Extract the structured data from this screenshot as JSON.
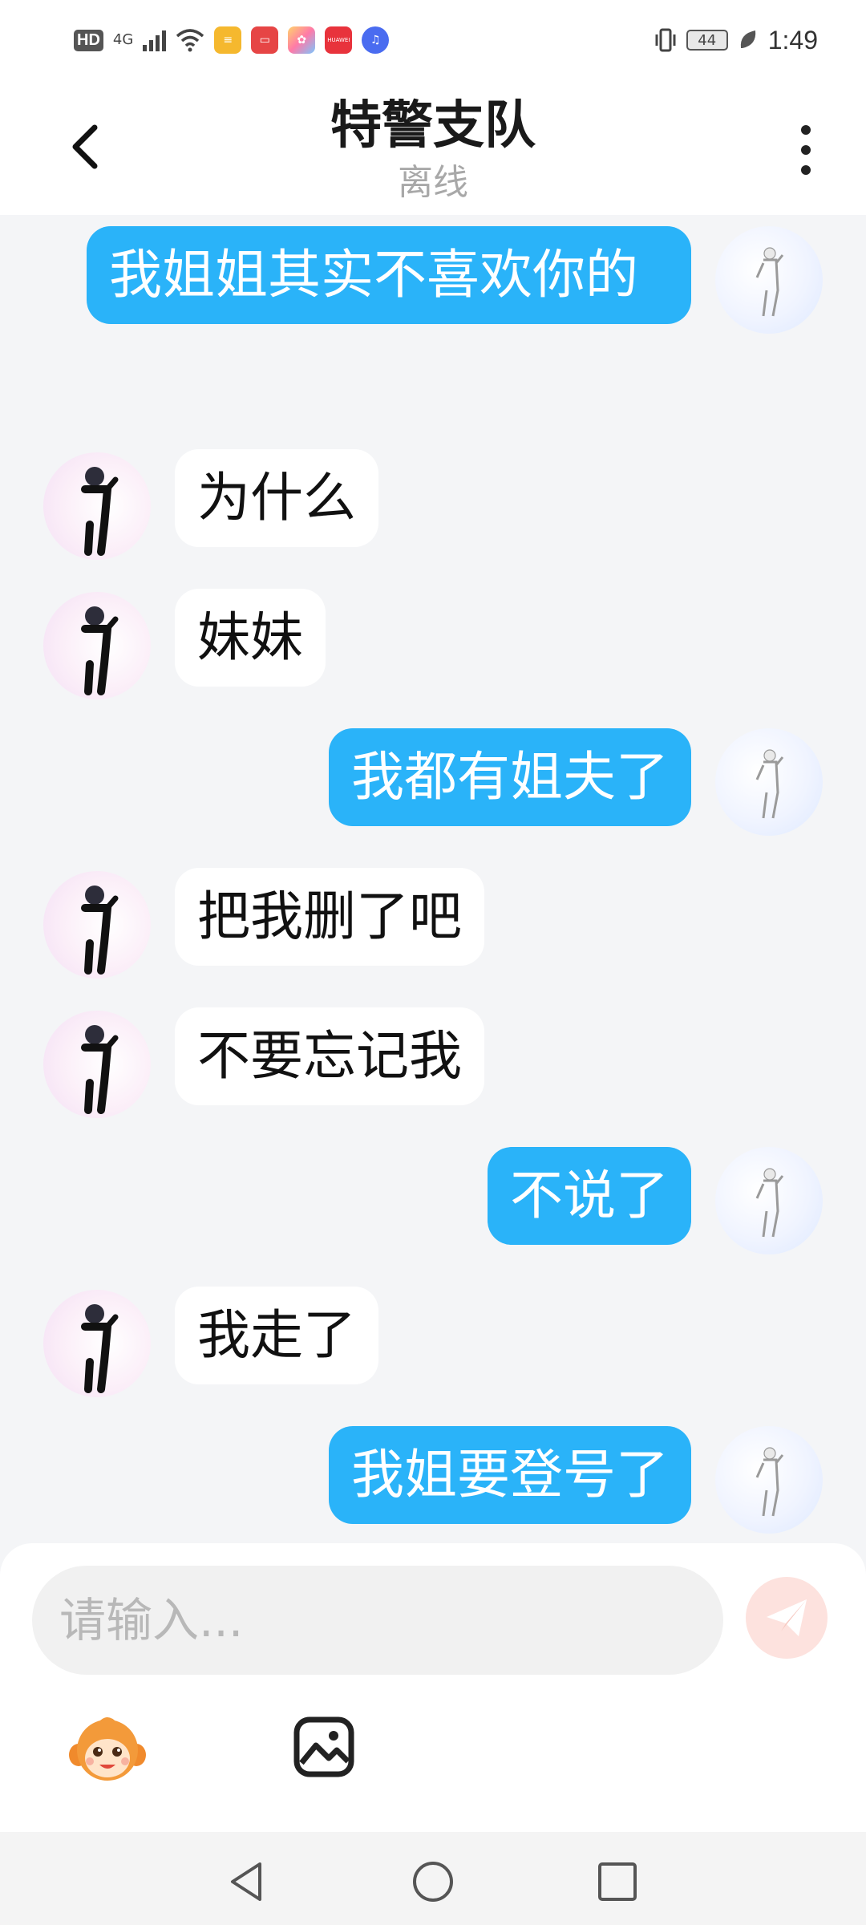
{
  "status_bar": {
    "hd_label": "HD",
    "network_label": "4G",
    "battery_level": "44",
    "time": "1:49",
    "app_icons": [
      "wallet-icon",
      "books-icon",
      "gallery-icon",
      "huawei-store-icon",
      "music-icon"
    ],
    "store_label": "HUAWEI"
  },
  "header": {
    "title": "特警支队",
    "subtitle": "离线"
  },
  "colors": {
    "outgoing_bubble": "#2ab3f9",
    "incoming_bubble": "#ffffff",
    "background": "#f4f5f7",
    "send_button": "#fde2de"
  },
  "messages": [
    {
      "side": "out",
      "text": "我姐姐其实不喜欢你的"
    },
    {
      "side": "in",
      "text": "为什么"
    },
    {
      "side": "in",
      "text": "妹妹"
    },
    {
      "side": "out",
      "text": "我都有姐夫了"
    },
    {
      "side": "in",
      "text": "把我删了吧"
    },
    {
      "side": "in",
      "text": "不要忘记我"
    },
    {
      "side": "out",
      "text": "不说了"
    },
    {
      "side": "in",
      "text": "我走了"
    },
    {
      "side": "out",
      "text": "我姐要登号了"
    }
  ],
  "composer": {
    "placeholder": "请输入...",
    "value": ""
  }
}
